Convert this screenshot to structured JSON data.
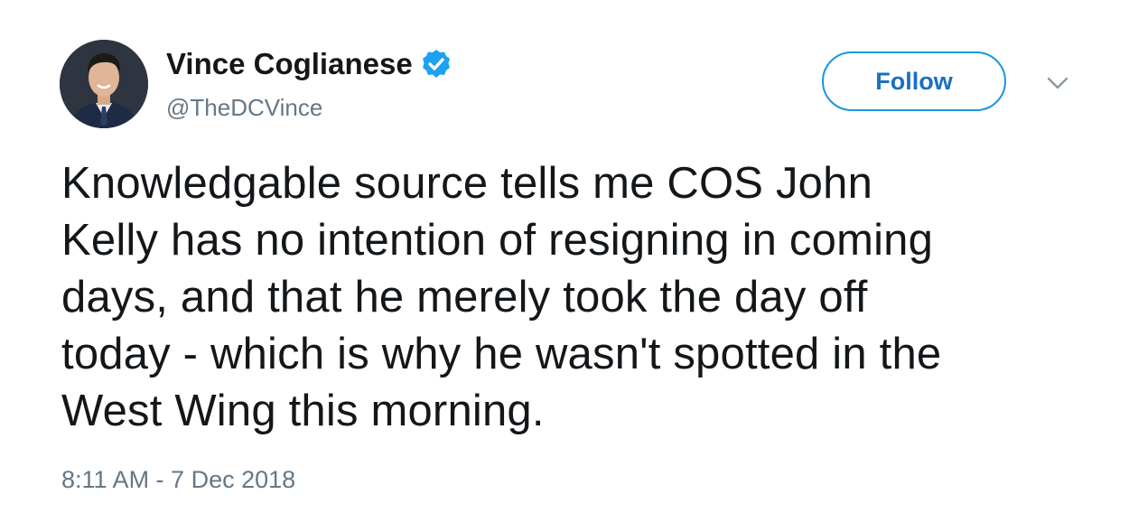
{
  "author": {
    "name": "Vince Coglianese",
    "handle": "@TheDCVince",
    "verified": true,
    "avatar_icon": "profile-photo"
  },
  "actions": {
    "follow_label": "Follow",
    "menu_icon": "chevron-down-icon"
  },
  "tweet": {
    "lines": [
      "Knowledgable source tells me COS John",
      "Kelly has no intention of resigning in coming",
      "days, and that he merely took the day off",
      "today - which is why he wasn't spotted in the",
      "West Wing this morning."
    ],
    "timestamp": "8:11 AM - 7 Dec 2018"
  },
  "colors": {
    "accent": "#1da1f2",
    "text": "#14171a",
    "secondary": "#657786"
  }
}
